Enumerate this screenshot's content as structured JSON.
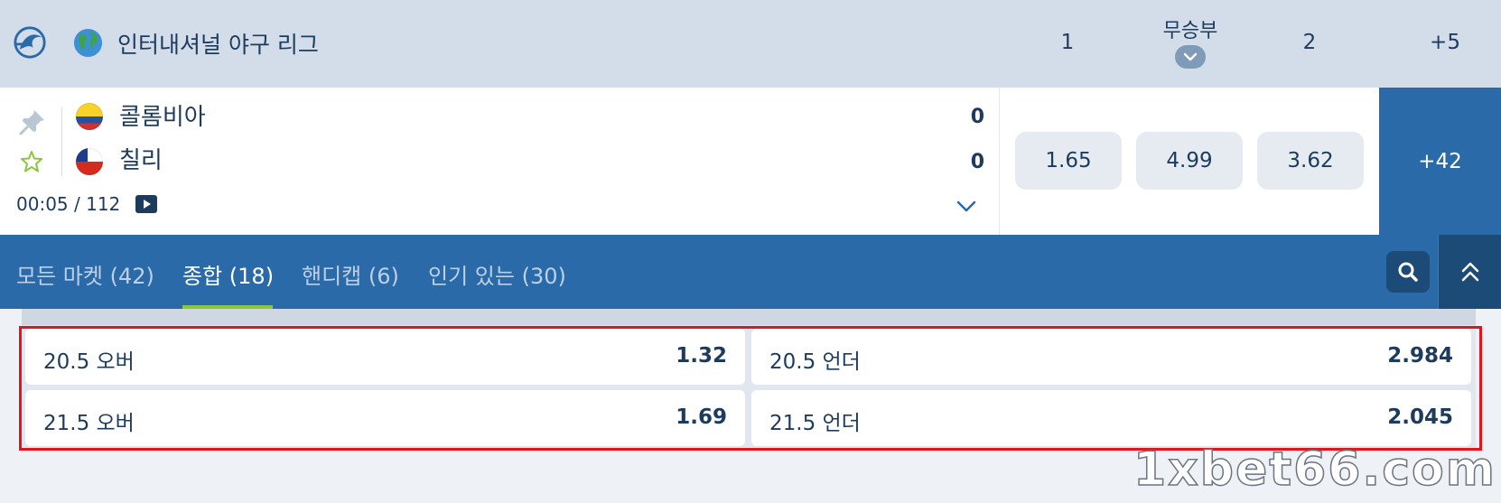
{
  "header": {
    "league_title": "인터내셔널 야구 리그",
    "col_1": "1",
    "col_draw": "무승부",
    "col_2": "2",
    "col_more": "+5",
    "brand_icon": "brand-logo-icon",
    "globe_icon": "globe-icon"
  },
  "match": {
    "home_team": "콜롬비아",
    "away_team": "칠리",
    "home_score": "0",
    "away_score": "0",
    "time": "00:05 / 112",
    "odds": {
      "home": "1.65",
      "draw": "4.99",
      "away": "3.62"
    },
    "more_markets": "+42"
  },
  "tabs": [
    {
      "label": "모든 마켓 (42)",
      "active": false
    },
    {
      "label": "종합 (18)",
      "active": true
    },
    {
      "label": "핸디캡 (6)",
      "active": false
    },
    {
      "label": "인기 있는 (30)",
      "active": false
    }
  ],
  "markets": [
    {
      "label": "20.5 오버",
      "odd": "1.32"
    },
    {
      "label": "20.5 언더",
      "odd": "2.984"
    },
    {
      "label": "21.5 오버",
      "odd": "1.69"
    },
    {
      "label": "21.5 언더",
      "odd": "2.045"
    }
  ],
  "colors": {
    "header_bg": "#d3dde9",
    "primary_blue": "#2a6aa8",
    "dark_blue": "#1d4b78",
    "active_tab_underline": "#8cc63f",
    "highlight_frame": "#e3141b"
  },
  "watermark": "1xbet66.com"
}
